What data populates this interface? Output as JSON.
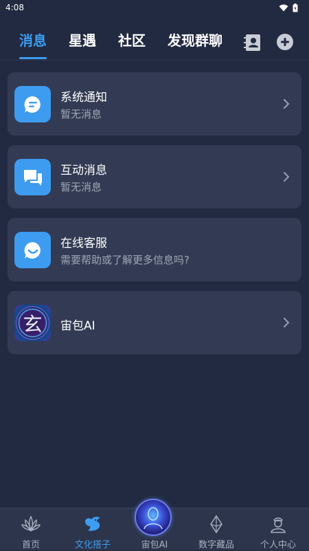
{
  "status_bar": {
    "time": "4:08"
  },
  "top_tabs": [
    {
      "label": "消息",
      "active": true
    },
    {
      "label": "星遇",
      "active": false
    },
    {
      "label": "社区",
      "active": false
    },
    {
      "label": "发现群聊",
      "active": false
    }
  ],
  "messages": [
    {
      "title": "系统通知",
      "subtitle": "暂无消息",
      "icon": "notice-icon"
    },
    {
      "title": "互动消息",
      "subtitle": "暂无消息",
      "icon": "chat-bubbles-icon"
    },
    {
      "title": "在线客服",
      "subtitle": "需要帮助或了解更多信息吗?",
      "icon": "support-smile-icon"
    },
    {
      "title": "宙包AI",
      "subtitle": "",
      "icon": "ai-xuan-logo"
    }
  ],
  "ai_logo_text": "玄",
  "bottom_nav": [
    {
      "label": "首页",
      "active": false,
      "icon": "lotus-icon"
    },
    {
      "label": "文化搭子",
      "active": true,
      "icon": "bird-icon"
    },
    {
      "label": "宙包AI",
      "active": false,
      "icon": "ai-orb-icon"
    },
    {
      "label": "数字藏品",
      "active": false,
      "icon": "crystal-icon"
    },
    {
      "label": "个人中心",
      "active": false,
      "icon": "person-icon"
    }
  ],
  "colors": {
    "background": "#222a41",
    "card": "#323b53",
    "accent": "#3d9cf0"
  }
}
